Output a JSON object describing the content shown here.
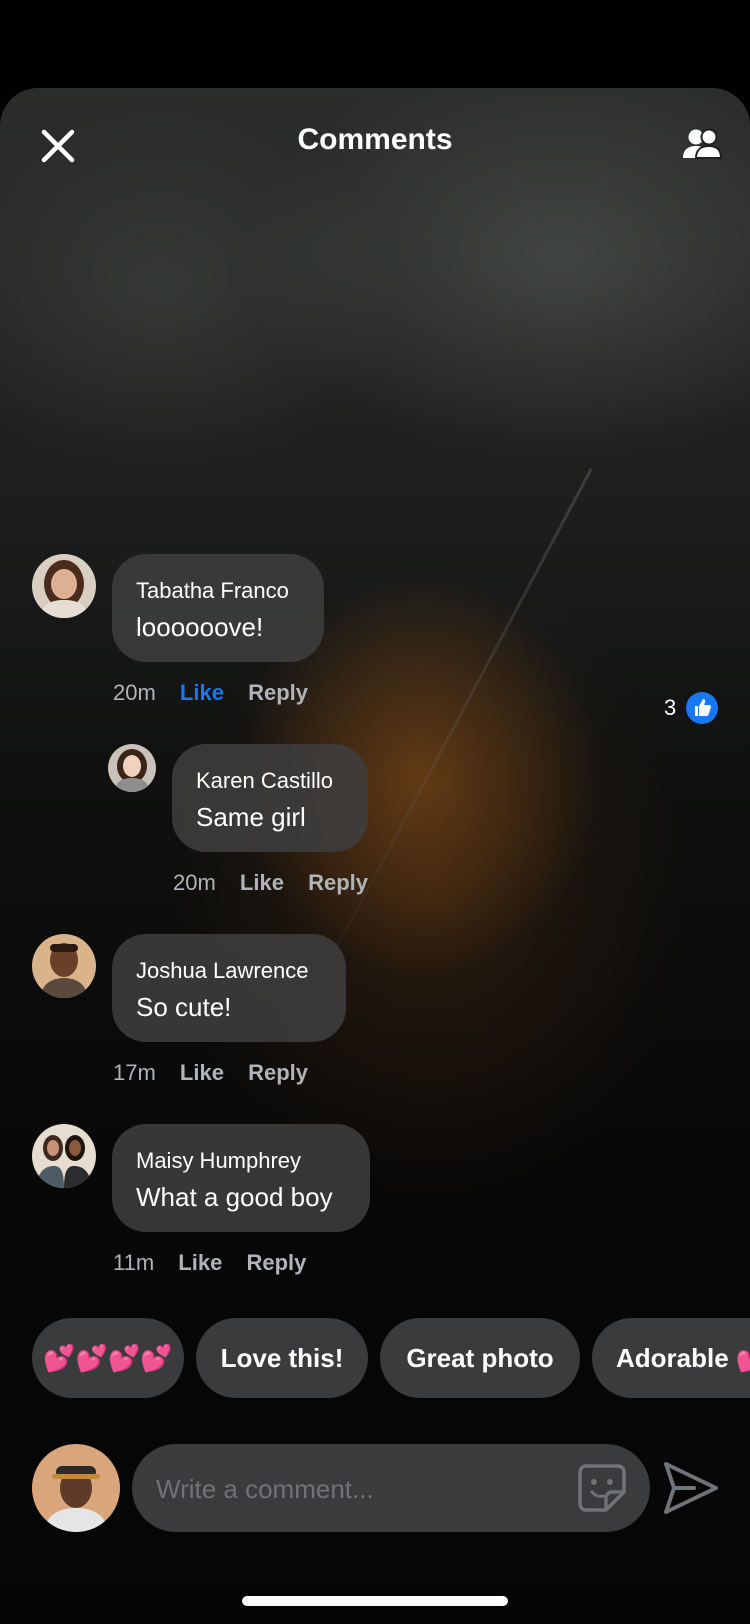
{
  "header": {
    "title": "Comments"
  },
  "comments": [
    {
      "name": "Tabatha Franco",
      "text": "loooooove!",
      "time": "20m",
      "like_label": "Like",
      "reply_label": "Reply",
      "liked": true,
      "reaction_count": "3"
    },
    {
      "name": "Karen Castillo",
      "text": "Same girl",
      "time": "20m",
      "like_label": "Like",
      "reply_label": "Reply"
    },
    {
      "name": "Joshua Lawrence",
      "text": "So cute!",
      "time": "17m",
      "like_label": "Like",
      "reply_label": "Reply"
    },
    {
      "name": "Maisy Humphrey",
      "text": "What a good boy",
      "time": "11m",
      "like_label": "Like",
      "reply_label": "Reply"
    }
  ],
  "quick_replies": [
    "💕💕💕💕",
    "Love this!",
    "Great photo",
    "Adorable 💕"
  ],
  "composer": {
    "placeholder": "Write a comment..."
  },
  "colors": {
    "accent": "#1877f2",
    "bubble": "#3e3e3e",
    "chip": "#3a3b3c",
    "muted": "#b0b3b8"
  },
  "icons": {
    "close": "close-icon",
    "friends": "friends-icon",
    "like": "thumbs-up-icon",
    "sticker": "sticker-icon",
    "send": "send-icon"
  }
}
